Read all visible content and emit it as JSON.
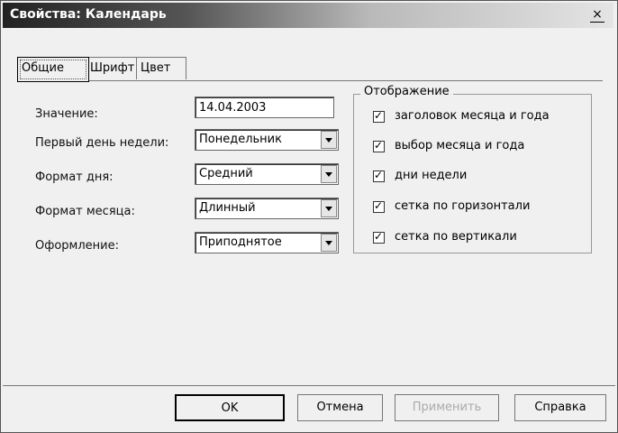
{
  "window": {
    "title": "Свойства: Календарь",
    "close_symbol": "×"
  },
  "tabs": [
    {
      "label": "Общие",
      "active": true
    },
    {
      "label": "Шрифт",
      "active": false
    },
    {
      "label": "Цвет",
      "active": false
    }
  ],
  "form": {
    "value_label": "Значение:",
    "value": "14.04.2003",
    "first_day_label": "Первый день недели:",
    "first_day_value": "Понедельник",
    "day_format_label": "Формат дня:",
    "day_format_value": "Средний",
    "month_format_label": "Формат месяца:",
    "month_format_value": "Длинный",
    "style_label": "Оформление:",
    "style_value": "Приподнятое"
  },
  "display_group": {
    "title": "Отображение",
    "options": [
      {
        "label": "заголовок месяца и года",
        "checked": true
      },
      {
        "label": "выбор месяца и года",
        "checked": true
      },
      {
        "label": "дни недели",
        "checked": true
      },
      {
        "label": "сетка по горизонтали",
        "checked": true
      },
      {
        "label": "сетка по вертикали",
        "checked": true
      }
    ]
  },
  "buttons": {
    "ok": "OK",
    "cancel": "Отмена",
    "apply": "Применить",
    "help": "Справка"
  }
}
